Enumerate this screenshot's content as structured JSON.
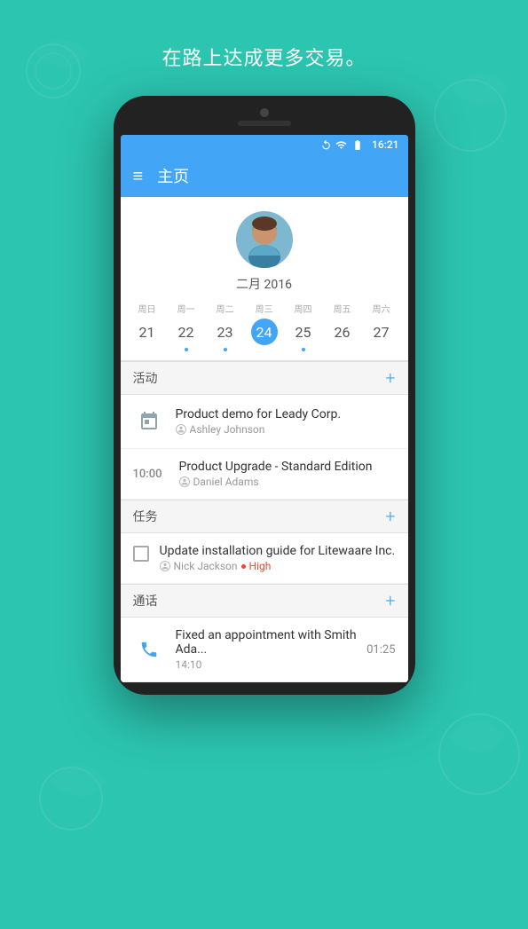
{
  "page": {
    "tagline": "在路上达成更多交易。",
    "bg_color": "#2cc5b0"
  },
  "status_bar": {
    "time": "16:21",
    "icons": [
      "rotate",
      "wifi",
      "battery"
    ]
  },
  "app_bar": {
    "title": "主页",
    "menu_icon": "≡"
  },
  "profile": {
    "month_year": "二月 2016"
  },
  "calendar": {
    "days": [
      {
        "name": "周日",
        "num": "21",
        "active": false,
        "dot": false
      },
      {
        "name": "周一",
        "num": "22",
        "active": false,
        "dot": true
      },
      {
        "name": "周二",
        "num": "23",
        "active": false,
        "dot": true
      },
      {
        "name": "周三",
        "num": "24",
        "active": true,
        "dot": true
      },
      {
        "name": "周四",
        "num": "25",
        "active": false,
        "dot": true
      },
      {
        "name": "周五",
        "num": "26",
        "active": false,
        "dot": false
      },
      {
        "name": "周六",
        "num": "27",
        "active": false,
        "dot": false
      }
    ]
  },
  "sections": {
    "activities": {
      "title": "活动",
      "add_label": "+",
      "items": [
        {
          "type": "calendar",
          "time": "",
          "title": "Product demo for Leady Corp.",
          "person": "Ashley Johnson"
        },
        {
          "type": "time",
          "time": "10:00",
          "title": "Product Upgrade - Standard Edition",
          "person": "Daniel Adams"
        }
      ]
    },
    "tasks": {
      "title": "任务",
      "add_label": "+",
      "items": [
        {
          "title": "Update installation guide for Litewaare Inc.",
          "person": "Nick Jackson",
          "priority": "High"
        }
      ]
    },
    "calls": {
      "title": "通话",
      "add_label": "+",
      "items": [
        {
          "title": "Fixed an appointment with Smith Ada...",
          "start_time": "14:10",
          "duration": "01:25"
        }
      ]
    }
  }
}
